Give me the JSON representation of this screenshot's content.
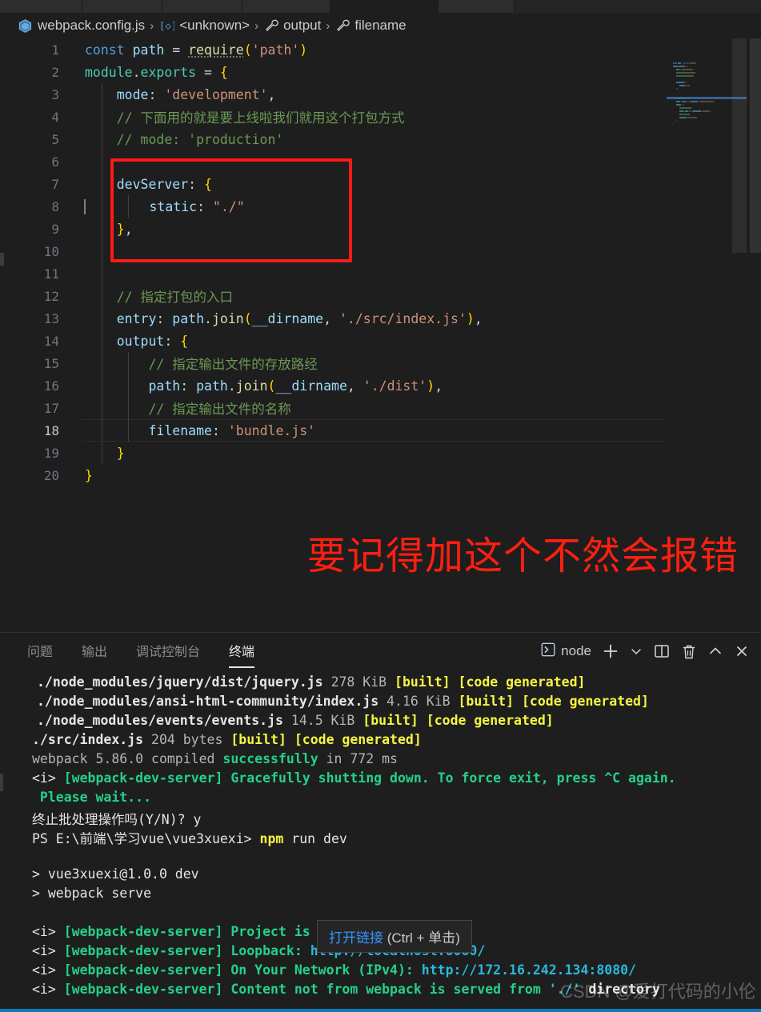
{
  "window": {
    "theme_bg": "#1e1e1e",
    "accent": "#1177bb"
  },
  "tabstrip": {
    "segments": [
      {
        "name": "tab-1",
        "width": 103,
        "active": false
      },
      {
        "name": "tab-2",
        "width": 100,
        "active": false
      },
      {
        "name": "tab-3",
        "width": 100,
        "active": false
      },
      {
        "name": "tab-4",
        "width": 110,
        "active": true
      },
      {
        "name": "tab-5",
        "width": 135,
        "active": false
      },
      {
        "name": "tab-6",
        "width": 158,
        "active": false
      }
    ]
  },
  "breadcrumb": {
    "items": [
      {
        "icon": "webpack-cube-icon",
        "label": "webpack.config.js"
      },
      {
        "icon": "module-brackets-icon",
        "label": "<unknown>"
      },
      {
        "icon": "wrench-icon",
        "label": "output"
      },
      {
        "icon": "wrench-icon",
        "label": "filename"
      }
    ],
    "separator": "›"
  },
  "editor": {
    "file_name": "webpack.config.js",
    "active_line": 18,
    "total_lines": 20,
    "lines": [
      {
        "n": 1,
        "tokens": [
          {
            "t": "const",
            "c": "kw"
          },
          {
            "t": " ",
            "c": "pun"
          },
          {
            "t": "path",
            "c": "id"
          },
          {
            "t": " = ",
            "c": "pun"
          },
          {
            "t": "require",
            "c": "fn sq"
          },
          {
            "t": "(",
            "c": "br1"
          },
          {
            "t": "'path'",
            "c": "str"
          },
          {
            "t": ")",
            "c": "br1"
          }
        ]
      },
      {
        "n": 2,
        "tokens": [
          {
            "t": "module",
            "c": "t-green-id"
          },
          {
            "t": ".",
            "c": "pun"
          },
          {
            "t": "exports",
            "c": "t-green-id"
          },
          {
            "t": " = ",
            "c": "pun"
          },
          {
            "t": "{",
            "c": "br1"
          }
        ]
      },
      {
        "n": 3,
        "tokens": [
          {
            "t": "    ",
            "c": "pun"
          },
          {
            "t": "mode",
            "c": "prop"
          },
          {
            "t": ": ",
            "c": "pun"
          },
          {
            "t": "'development'",
            "c": "str"
          },
          {
            "t": ",",
            "c": "pun"
          }
        ]
      },
      {
        "n": 4,
        "tokens": [
          {
            "t": "    // 下面用的就是要上线啦我们就用这个打包方式",
            "c": "cmt"
          }
        ]
      },
      {
        "n": 5,
        "tokens": [
          {
            "t": "    // mode: 'production'",
            "c": "cmt"
          }
        ]
      },
      {
        "n": 6,
        "tokens": []
      },
      {
        "n": 7,
        "tokens": [
          {
            "t": "    ",
            "c": "pun"
          },
          {
            "t": "devServer",
            "c": "prop"
          },
          {
            "t": ": ",
            "c": "pun"
          },
          {
            "t": "{",
            "c": "br1"
          }
        ]
      },
      {
        "n": 8,
        "tokens": [
          {
            "t": "        ",
            "c": "pun"
          },
          {
            "t": "static",
            "c": "prop"
          },
          {
            "t": ": ",
            "c": "pun"
          },
          {
            "t": "\"./\"",
            "c": "str"
          }
        ]
      },
      {
        "n": 9,
        "tokens": [
          {
            "t": "    ",
            "c": "pun"
          },
          {
            "t": "}",
            "c": "br1"
          },
          {
            "t": ",",
            "c": "pun"
          }
        ]
      },
      {
        "n": 10,
        "tokens": []
      },
      {
        "n": 11,
        "tokens": []
      },
      {
        "n": 12,
        "tokens": [
          {
            "t": "    // 指定打包的入口",
            "c": "cmt"
          }
        ]
      },
      {
        "n": 13,
        "tokens": [
          {
            "t": "    ",
            "c": "pun"
          },
          {
            "t": "entry",
            "c": "prop"
          },
          {
            "t": ": ",
            "c": "pun"
          },
          {
            "t": "path",
            "c": "id"
          },
          {
            "t": ".",
            "c": "pun"
          },
          {
            "t": "join",
            "c": "fn"
          },
          {
            "t": "(",
            "c": "br1"
          },
          {
            "t": "__dirname",
            "c": "id"
          },
          {
            "t": ", ",
            "c": "pun"
          },
          {
            "t": "'./src/index.js'",
            "c": "str"
          },
          {
            "t": ")",
            "c": "br1"
          },
          {
            "t": ",",
            "c": "pun"
          }
        ]
      },
      {
        "n": 14,
        "tokens": [
          {
            "t": "    ",
            "c": "pun"
          },
          {
            "t": "output",
            "c": "prop"
          },
          {
            "t": ": ",
            "c": "pun"
          },
          {
            "t": "{",
            "c": "br1"
          }
        ]
      },
      {
        "n": 15,
        "tokens": [
          {
            "t": "        // 指定输出文件的存放路经",
            "c": "cmt"
          }
        ]
      },
      {
        "n": 16,
        "tokens": [
          {
            "t": "        ",
            "c": "pun"
          },
          {
            "t": "path",
            "c": "prop"
          },
          {
            "t": ": ",
            "c": "pun"
          },
          {
            "t": "path",
            "c": "id"
          },
          {
            "t": ".",
            "c": "pun"
          },
          {
            "t": "join",
            "c": "fn"
          },
          {
            "t": "(",
            "c": "br1"
          },
          {
            "t": "__dirname",
            "c": "id"
          },
          {
            "t": ", ",
            "c": "pun"
          },
          {
            "t": "'./dist'",
            "c": "str"
          },
          {
            "t": ")",
            "c": "br1"
          },
          {
            "t": ",",
            "c": "pun"
          }
        ]
      },
      {
        "n": 17,
        "tokens": [
          {
            "t": "        // 指定输出文件的名称",
            "c": "cmt"
          }
        ]
      },
      {
        "n": 18,
        "tokens": [
          {
            "t": "        ",
            "c": "pun"
          },
          {
            "t": "filename",
            "c": "prop"
          },
          {
            "t": ": ",
            "c": "pun"
          },
          {
            "t": "'bundle.js'",
            "c": "str"
          }
        ]
      },
      {
        "n": 19,
        "tokens": [
          {
            "t": "    ",
            "c": "pun"
          },
          {
            "t": "}",
            "c": "br1"
          }
        ]
      },
      {
        "n": 20,
        "tokens": [
          {
            "t": "}",
            "c": "br1"
          }
        ]
      }
    ],
    "annotations": {
      "red_box_label": "devServer-highlight-box",
      "red_box_color": "#ff1a1a",
      "red_note_text": "要记得加这个不然会报错",
      "red_note_color": "#ff1f10"
    }
  },
  "panel": {
    "tabs": [
      {
        "label": "问题",
        "active": false
      },
      {
        "label": "输出",
        "active": false
      },
      {
        "label": "调试控制台",
        "active": false
      },
      {
        "label": "终端",
        "active": true
      }
    ],
    "actions": {
      "shell_icon": "terminal-prompt-icon",
      "shell_label": "node",
      "new_terminal_icon": "plus-icon",
      "dropdown_icon": "chevron-down-icon",
      "split_icon": "split-panel-icon",
      "kill_icon": "trash-icon",
      "collapse_icon": "chevron-up-icon",
      "close_icon": "close-icon"
    }
  },
  "terminal": {
    "lines": [
      {
        "indent": "i2",
        "parts": [
          {
            "t": "./node_modules/jquery/dist/jquery.js ",
            "c": "t-white t-bold"
          },
          {
            "t": "278 KiB ",
            "c": "t-gray"
          },
          {
            "t": "[built] [code generated]",
            "c": "t-yellow"
          }
        ]
      },
      {
        "indent": "i2",
        "parts": [
          {
            "t": "./node_modules/ansi-html-community/index.js ",
            "c": "t-white t-bold"
          },
          {
            "t": "4.16 KiB ",
            "c": "t-gray"
          },
          {
            "t": "[built] [code generated]",
            "c": "t-yellow"
          }
        ]
      },
      {
        "indent": "i2",
        "parts": [
          {
            "t": "./node_modules/events/events.js ",
            "c": "t-white t-bold"
          },
          {
            "t": "14.5 KiB ",
            "c": "t-gray"
          },
          {
            "t": "[built] [code generated]",
            "c": "t-yellow"
          }
        ]
      },
      {
        "indent": "i1",
        "parts": [
          {
            "t": "./src/index.js ",
            "c": "t-white t-bold"
          },
          {
            "t": "204 bytes ",
            "c": "t-gray"
          },
          {
            "t": "[built] [code generated]",
            "c": "t-yellow"
          }
        ]
      },
      {
        "indent": "i1",
        "parts": [
          {
            "t": "webpack 5.86.0 compiled ",
            "c": "t-gray"
          },
          {
            "t": "successfully",
            "c": "t-greenb"
          },
          {
            "t": " in 772 ms",
            "c": "t-gray"
          }
        ]
      },
      {
        "indent": "i1",
        "parts": [
          {
            "t": "<i> ",
            "c": "t-white"
          },
          {
            "t": "[webpack-dev-server] Gracefully shutting down. To force exit, press ^C again.",
            "c": "t-greenb"
          }
        ]
      },
      {
        "indent": "i1",
        "parts": [
          {
            "t": " Please wait...",
            "c": "t-greenb"
          }
        ]
      },
      {
        "indent": "i1",
        "parts": [
          {
            "t": "终止批处理操作吗(Y/N)? y",
            "c": "t-white"
          }
        ]
      },
      {
        "indent": "i1",
        "parts": [
          {
            "t": "PS E:\\前端\\学习vue\\vue3xuexi> ",
            "c": "t-white"
          },
          {
            "t": "npm",
            "c": "t-yellow"
          },
          {
            "t": " run dev",
            "c": "t-white"
          }
        ]
      },
      {
        "indent": "i1",
        "parts": [
          {
            "t": "",
            "c": "t-white"
          }
        ]
      },
      {
        "indent": "i1",
        "parts": [
          {
            "t": "> vue3xuexi@1.0.0 dev",
            "c": "t-white"
          }
        ]
      },
      {
        "indent": "i1",
        "parts": [
          {
            "t": "> webpack serve",
            "c": "t-white"
          }
        ]
      },
      {
        "indent": "i1",
        "parts": [
          {
            "t": "",
            "c": "t-white"
          }
        ]
      },
      {
        "indent": "i1",
        "parts": [
          {
            "t": "<i> ",
            "c": "t-white"
          },
          {
            "t": "[webpack-dev-server] Project is running at:",
            "c": "t-greenb"
          }
        ]
      },
      {
        "indent": "i1",
        "parts": [
          {
            "t": "<i> ",
            "c": "t-white"
          },
          {
            "t": "[webpack-dev-server] Loopback: ",
            "c": "t-greenb"
          },
          {
            "t": "http://localhost:8080/",
            "c": "t-cyanb"
          }
        ]
      },
      {
        "indent": "i1",
        "parts": [
          {
            "t": "<i> ",
            "c": "t-white"
          },
          {
            "t": "[webpack-dev-server] On Your Network (IPv4): ",
            "c": "t-greenb"
          },
          {
            "t": "http://172.16.242.134:8080/",
            "c": "t-cyanb"
          }
        ]
      },
      {
        "indent": "i1",
        "parts": [
          {
            "t": "<i> ",
            "c": "t-white"
          },
          {
            "t": "[webpack-dev-server] Content not from webpack is served from ",
            "c": "t-greenb"
          },
          {
            "t": "'./'",
            "c": "t-cyanb"
          },
          {
            "t": " directory",
            "c": "t-white t-bold"
          }
        ]
      }
    ]
  },
  "tooltip": {
    "link_label": "打开链接",
    "hint": " (Ctrl + 单击)"
  },
  "watermark": {
    "text": "CSDN @爱打代码的小伦"
  }
}
